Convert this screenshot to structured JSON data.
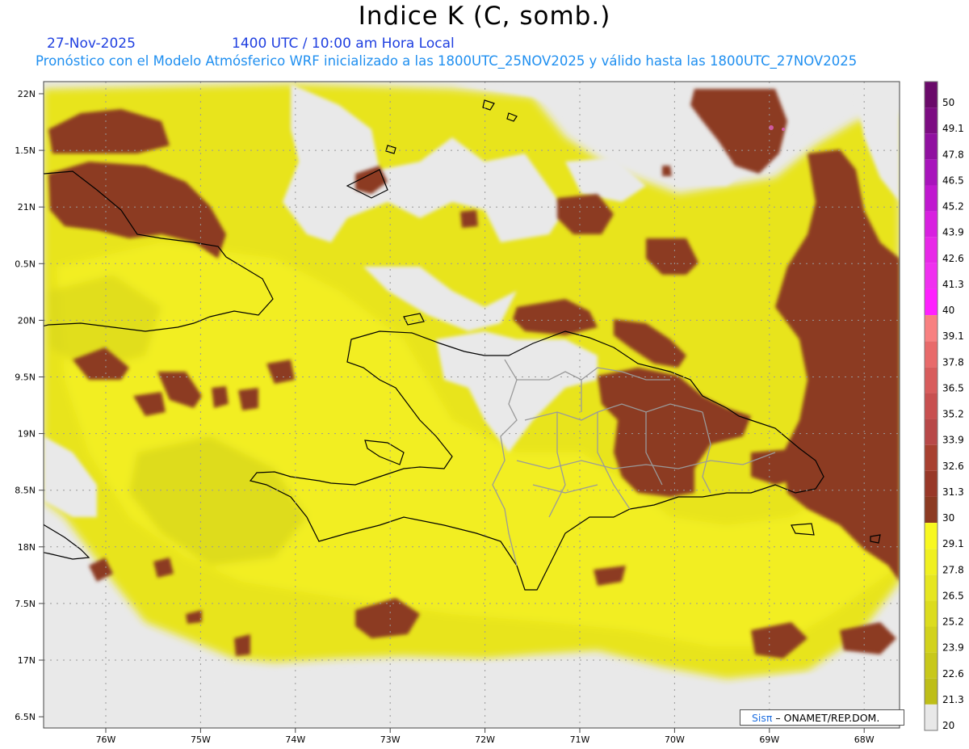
{
  "title": "Indice K (C, somb.)",
  "date": "27-Nov-2025",
  "time": "1400 UTC / 10:00 am Hora Local",
  "forecast_line": "Pronóstico con el Modelo Atmósferico WRF inicializado a las 1800UTC_25NOV2025 y válido hasta las  1800UTC_27NOV2025",
  "credit": {
    "brand": "Sisπ",
    "rest": " – ONAMET/REP.DOM."
  },
  "lat_labels": [
    "22N",
    "1.5N",
    "21N",
    "0.5N",
    "20N",
    "9.5N",
    "19N",
    "8.5N",
    "18N",
    "7.5N",
    "17N",
    "6.5N"
  ],
  "lon_labels": [
    "76W",
    "75W",
    "74W",
    "73W",
    "72W",
    "71W",
    "70W",
    "69W",
    "68W"
  ],
  "colorbar": {
    "labels": [
      "50",
      "49.1",
      "47.8",
      "46.5",
      "45.2",
      "43.9",
      "42.6",
      "41.3",
      "40",
      "39.1",
      "37.8",
      "36.5",
      "35.2",
      "33.9",
      "32.6",
      "31.3",
      "30",
      "29.1",
      "27.8",
      "26.5",
      "25.2",
      "23.9",
      "22.6",
      "21.3",
      "20"
    ],
    "colors": [
      "#6a0a6a",
      "#7c0c82",
      "#9010a0",
      "#a814bc",
      "#c018d0",
      "#d820e0",
      "#e828e8",
      "#f030f0",
      "#ff20ff",
      "#f88080",
      "#e86a6a",
      "#d85c5c",
      "#c85050",
      "#b84848",
      "#a84030",
      "#983828",
      "#8c3a22",
      "#f8f820",
      "#f0f020",
      "#e6e620",
      "#dcdc1e",
      "#d2d21c",
      "#c8c81a",
      "#bebe18",
      "#e8e8e8"
    ]
  },
  "legend_values": {
    "max": 50,
    "min": 20,
    "threshold": 30
  }
}
